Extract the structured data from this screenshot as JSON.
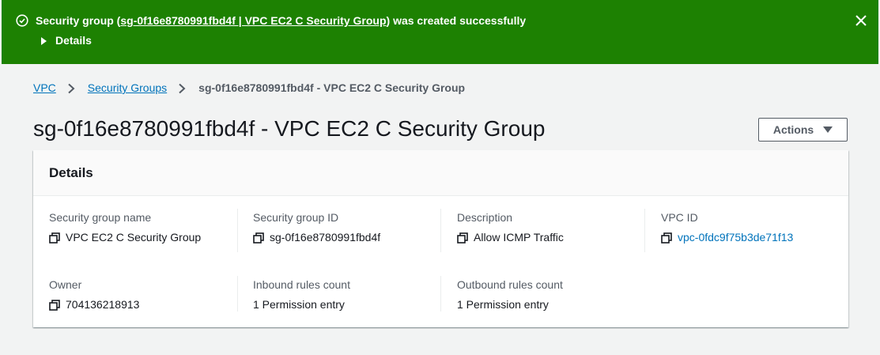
{
  "flash": {
    "prefix": "Security group (",
    "link": "sg-0f16e8780991fbd4f | VPC EC2 C Security Group",
    "suffix": ") was created successfully",
    "details_label": "Details",
    "color": "#1d8102"
  },
  "breadcrumb": {
    "items": [
      "VPC",
      "Security Groups"
    ],
    "current": "sg-0f16e8780991fbd4f - VPC EC2 C Security Group"
  },
  "page": {
    "title": "sg-0f16e8780991fbd4f - VPC EC2 C Security Group",
    "actions_label": "Actions"
  },
  "details": {
    "title": "Details",
    "fields": [
      {
        "label": "Security group name",
        "value": "VPC EC2 C Security Group"
      },
      {
        "label": "Security group ID",
        "value": "sg-0f16e8780991fbd4f"
      },
      {
        "label": "Description",
        "value": "Allow ICMP Traffic"
      },
      {
        "label": "VPC ID",
        "value": "vpc-0fdc9f75b3de71f13"
      },
      {
        "label": "Owner",
        "value": "704136218913"
      },
      {
        "label": "Inbound rules count",
        "value": "1 Permission entry"
      },
      {
        "label": "Outbound rules count",
        "value": "1 Permission entry"
      }
    ]
  },
  "colors": {
    "link": "#0073bb",
    "text": "#16191f",
    "label": "#545b64",
    "background": "#f2f3f3"
  }
}
